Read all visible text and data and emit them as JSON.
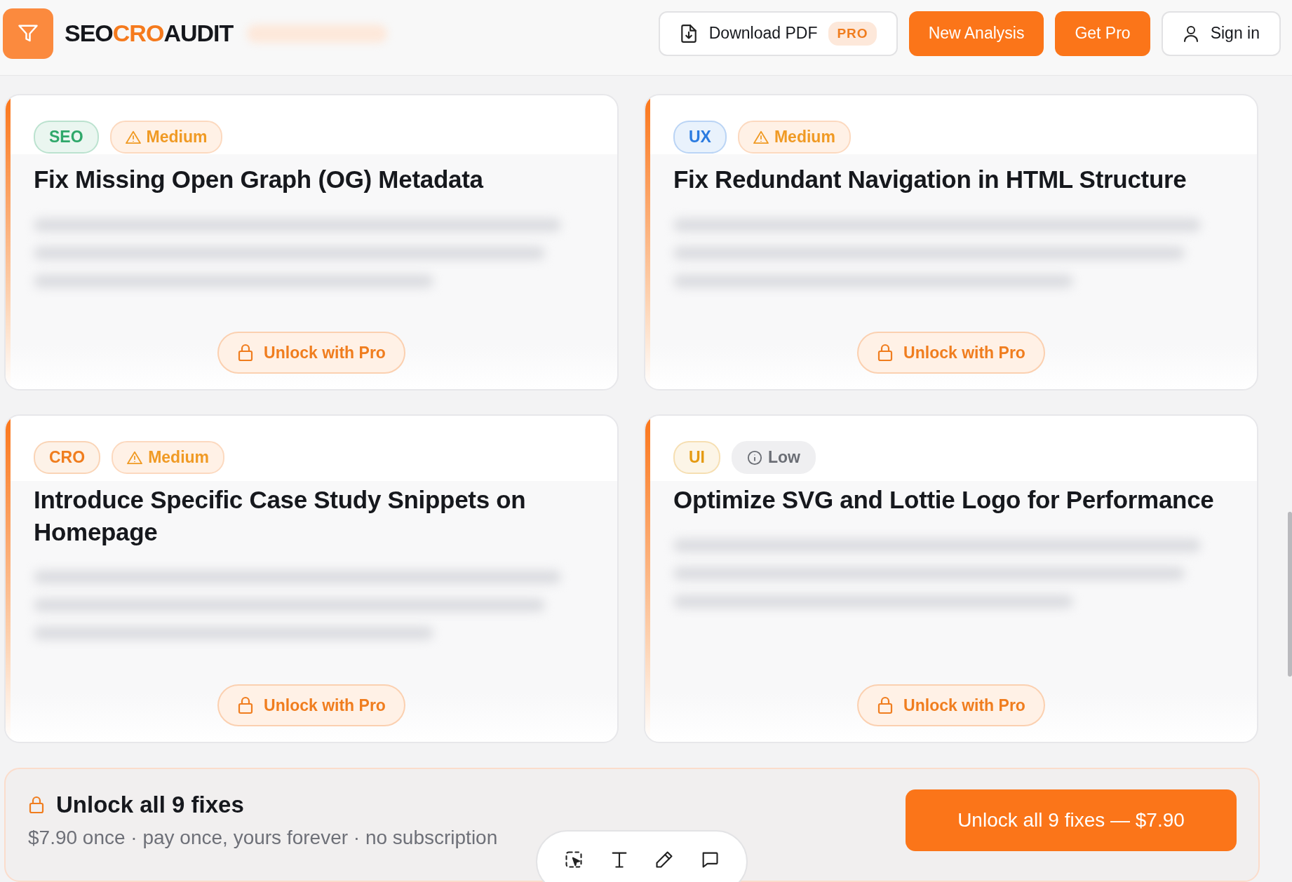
{
  "header": {
    "logo": [
      {
        "text": "SEO",
        "accent": false
      },
      {
        "text": "CRO",
        "accent": true
      },
      {
        "text": "AUDIT",
        "accent": false
      }
    ],
    "buttons": [
      {
        "kind": "download",
        "label": "Download PDF",
        "badge": "PRO"
      },
      {
        "kind": "primary",
        "label": "New Analysis"
      },
      {
        "kind": "primary",
        "label": "Get Pro"
      },
      {
        "kind": "account",
        "label": "Sign in"
      }
    ]
  },
  "fixes": [
    {
      "category": "SEO",
      "color": "#2fa86a",
      "severity": {
        "kind": "medium",
        "label": "Medium"
      },
      "title": "Fix Missing Open Graph (OG) Metadata",
      "action": "Unlock with Pro"
    },
    {
      "category": "UX",
      "color": "#2b7be0",
      "severity": {
        "kind": "medium",
        "label": "Medium"
      },
      "title": "Fix Redundant Navigation in HTML Structure",
      "action": "Unlock with Pro"
    },
    {
      "category": "CRO",
      "color": "#f07d1e",
      "severity": {
        "kind": "medium",
        "label": "Medium"
      },
      "title": "Introduce Specific Case Study Snippets on Homepage",
      "action": "Unlock with Pro"
    },
    {
      "category": "UI",
      "color": "#e59a12",
      "severity": {
        "kind": "low",
        "label": "Low"
      },
      "title": "Optimize SVG and Lottie Logo for Performance",
      "action": "Unlock with Pro"
    }
  ],
  "unlock_banner": {
    "title": "Unlock all 9 fixes",
    "subtitle": "$7.90 once · pay once, yours forever · no subscription",
    "button": "Unlock all 9 fixes — $7.90"
  },
  "floating_toolbar": [
    {
      "kind": "select"
    },
    {
      "kind": "text"
    },
    {
      "kind": "draw"
    },
    {
      "kind": "comment"
    }
  ]
}
